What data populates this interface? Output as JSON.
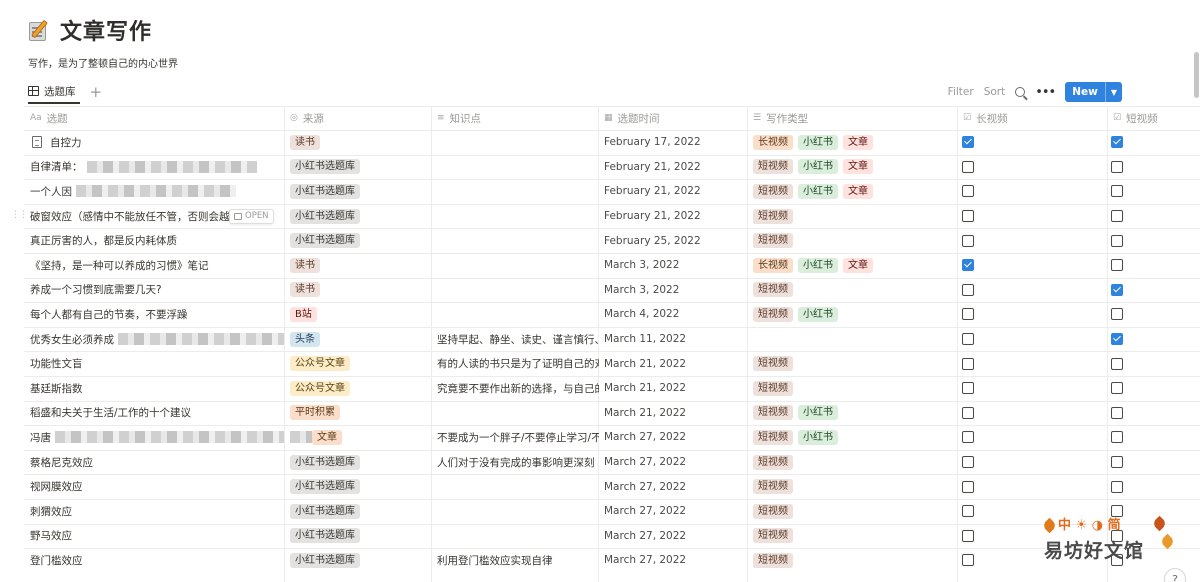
{
  "page": {
    "title": "文章写作",
    "description": "写作，是为了整顿自己的内心世界",
    "icon": "memo-icon"
  },
  "view": {
    "tab_label": "选题库",
    "add_icon": "plus-icon"
  },
  "toolbar": {
    "filter": "Filter",
    "sort": "Sort",
    "new_label": "New",
    "more_icon": "ellipsis-icon",
    "search_icon": "search-icon"
  },
  "columns": [
    {
      "label": "选题",
      "icon": "Aa"
    },
    {
      "label": "来源",
      "icon": "◎"
    },
    {
      "label": "知识点",
      "icon": "≡"
    },
    {
      "label": "选题时间",
      "icon": "▦"
    },
    {
      "label": "写作类型",
      "icon": "☰"
    },
    {
      "label": "长视频",
      "icon": "☑"
    },
    {
      "label": "短视频",
      "icon": "☑"
    }
  ],
  "open_label": "OPEN",
  "rows": [
    {
      "title": "自控力",
      "source": "读书",
      "source_color": "brown",
      "note": "",
      "date": "February 17, 2022",
      "types": [
        [
          "长视频",
          "orange"
        ],
        [
          "小红书",
          "green"
        ],
        [
          "文章",
          "red"
        ]
      ],
      "long": true,
      "short": true
    },
    {
      "title": "自律清单：",
      "source": "小红书选题库",
      "source_color": "grey",
      "note": "",
      "date": "February 21, 2022",
      "types": [
        [
          "短视频",
          "brown"
        ],
        [
          "小红书",
          "green"
        ],
        [
          "文章",
          "red"
        ]
      ],
      "long": false,
      "short": false
    },
    {
      "title": "一个人因",
      "source": "小红书选题库",
      "source_color": "grey",
      "note": "",
      "date": "February 21, 2022",
      "types": [
        [
          "短视频",
          "brown"
        ],
        [
          "小红书",
          "green"
        ],
        [
          "文章",
          "red"
        ]
      ],
      "long": false,
      "short": false
    },
    {
      "title": "破窗效应（感情中不能放任不管，否则会越",
      "source": "小红书选题库",
      "source_color": "grey",
      "note": "",
      "date": "February 21, 2022",
      "types": [
        [
          "短视频",
          "brown"
        ]
      ],
      "long": false,
      "short": false
    },
    {
      "title": "真正厉害的人，都是反内耗体质",
      "source": "小红书选题库",
      "source_color": "grey",
      "note": "",
      "date": "February 25, 2022",
      "types": [
        [
          "短视频",
          "brown"
        ]
      ],
      "long": false,
      "short": false
    },
    {
      "title": "《坚持，是一种可以养成的习惯》笔记",
      "source": "读书",
      "source_color": "brown",
      "note": "",
      "date": "March 3, 2022",
      "types": [
        [
          "长视频",
          "orange"
        ],
        [
          "小红书",
          "green"
        ],
        [
          "文章",
          "red"
        ]
      ],
      "long": true,
      "short": false
    },
    {
      "title": "养成一个习惯到底需要几天?",
      "source": "读书",
      "source_color": "brown",
      "note": "",
      "date": "March 3, 2022",
      "types": [
        [
          "短视频",
          "brown"
        ]
      ],
      "long": false,
      "short": true
    },
    {
      "title": "每个人都有自己的节奏，不要浮躁",
      "source": "B站",
      "source_color": "red",
      "note": "",
      "date": "March 4, 2022",
      "types": [
        [
          "短视频",
          "brown"
        ],
        [
          "小红书",
          "green"
        ]
      ],
      "long": false,
      "short": false
    },
    {
      "title": "优秀女生必须养成",
      "source": "头条",
      "source_color": "blue",
      "note": "坚持早起、静坐、读史、谨言慎行、",
      "date": "March 11, 2022",
      "types": [],
      "long": false,
      "short": true
    },
    {
      "title": "功能性文盲",
      "source": "公众号文章",
      "source_color": "yellow",
      "note": "有的人读的书只是为了证明自己的对",
      "date": "March 21, 2022",
      "types": [
        [
          "短视频",
          "brown"
        ]
      ],
      "long": false,
      "short": false
    },
    {
      "title": "基廷斯指数",
      "source": "公众号文章",
      "source_color": "yellow",
      "note": "究竟要不要作出新的选择，与自己的",
      "date": "March 21, 2022",
      "types": [
        [
          "短视频",
          "brown"
        ]
      ],
      "long": false,
      "short": false
    },
    {
      "title": "稻盛和夫关于生活/工作的十个建议",
      "source": "平时积累",
      "source_color": "orange",
      "note": "",
      "date": "March 21, 2022",
      "types": [
        [
          "短视频",
          "brown"
        ],
        [
          "小红书",
          "green"
        ]
      ],
      "long": false,
      "short": false
    },
    {
      "title": "冯唐",
      "source": "文章",
      "source_color": "orange",
      "note": "不要成为一个胖子/不要停止学习/不",
      "date": "March 27, 2022",
      "types": [
        [
          "短视频",
          "brown"
        ],
        [
          "小红书",
          "green"
        ]
      ],
      "long": false,
      "short": false
    },
    {
      "title": "蔡格尼克效应",
      "source": "小红书选题库",
      "source_color": "grey",
      "note": "人们对于没有完成的事影响更深刻",
      "date": "March 27, 2022",
      "types": [
        [
          "短视频",
          "brown"
        ]
      ],
      "long": false,
      "short": false
    },
    {
      "title": "视网膜效应",
      "source": "小红书选题库",
      "source_color": "grey",
      "note": "",
      "date": "March 27, 2022",
      "types": [
        [
          "短视频",
          "brown"
        ]
      ],
      "long": false,
      "short": false
    },
    {
      "title": "刺猬效应",
      "source": "小红书选题库",
      "source_color": "grey",
      "note": "",
      "date": "March 27, 2022",
      "types": [
        [
          "短视频",
          "brown"
        ]
      ],
      "long": false,
      "short": false
    },
    {
      "title": "野马效应",
      "source": "小红书选题库",
      "source_color": "grey",
      "note": "",
      "date": "March 27, 2022",
      "types": [
        [
          "短视频",
          "brown"
        ]
      ],
      "long": false,
      "short": false
    },
    {
      "title": "登门槛效应",
      "source": "小红书选题库",
      "source_color": "grey",
      "note": "利用登门槛效应实现自律",
      "date": "March 27, 2022",
      "types": [
        [
          "短视频",
          "brown"
        ]
      ],
      "long": false,
      "short": false
    }
  ],
  "watermark": {
    "top": "中 ☀ ◑ 简",
    "bottom": "易坊好文馆"
  },
  "help_label": "?"
}
